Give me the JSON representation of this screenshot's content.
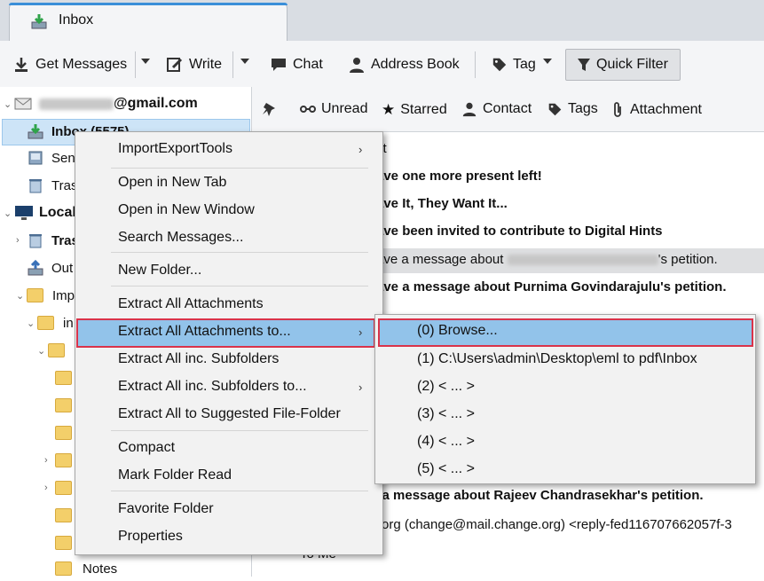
{
  "tab": {
    "title": "Inbox",
    "icon": "inbox-tray-icon"
  },
  "toolbar": {
    "get_messages": "Get Messages",
    "write": "Write",
    "chat": "Chat",
    "address_book": "Address Book",
    "tag": "Tag",
    "quick_filter": "Quick Filter"
  },
  "folders": {
    "account": "@gmail.com",
    "inbox": "Inbox (5575)",
    "sent": "Sen",
    "trash": "Tras",
    "local": "Local",
    "local_trash": "Tras",
    "outbox": "Out",
    "imp": "Imp",
    "in": "in",
    "sub": "I",
    "notes": "Notes"
  },
  "quickfilter": {
    "unread": "Unread",
    "starred": "Starred",
    "contact": "Contact",
    "tags": "Tags",
    "attachment": "Attachment"
  },
  "messages": [
    {
      "text": "ct",
      "bold": false
    },
    {
      "text": "ave one more present left!",
      "bold": true
    },
    {
      "text": "ave It, They Want It...",
      "bold": true
    },
    {
      "text": "ave been invited to contribute to Digital Hints",
      "bold": true
    },
    {
      "text": "ave a message about",
      "suffix": "'s petition.",
      "bold": false
    },
    {
      "text": "ave a message about Purnima Govindarajulu's petition.",
      "bold": true
    },
    {
      "text": "e a message about Rajeev Chandrasekhar's petition.",
      "bold": true
    },
    {
      "text": "org (change@mail.change.org) <reply-fed116707662057f-3",
      "bold": false
    },
    {
      "text": "To   Me",
      "bold": false
    }
  ],
  "context_menu": {
    "items": [
      {
        "label": "ImportExportTools",
        "submenu": true
      },
      {
        "label": "Open in New Tab"
      },
      {
        "label": "Open in New Window"
      },
      {
        "label": "Search Messages..."
      },
      {
        "label": "New Folder..."
      },
      {
        "label": "Extract All Attachments"
      },
      {
        "label": "Extract All Attachments to...",
        "submenu": true,
        "highlighted": true
      },
      {
        "label": "Extract All inc. Subfolders"
      },
      {
        "label": "Extract All inc. Subfolders to...",
        "submenu": true
      },
      {
        "label": "Extract All to Suggested File-Folder"
      },
      {
        "label": "Compact"
      },
      {
        "label": "Mark Folder Read"
      },
      {
        "label": "Favorite Folder"
      },
      {
        "label": "Properties"
      }
    ]
  },
  "submenu": {
    "items": [
      {
        "label": "(0) Browse...",
        "highlighted": true
      },
      {
        "label": "(1) C:\\Users\\admin\\Desktop\\eml to pdf\\Inbox"
      },
      {
        "label": "(2) < ... >"
      },
      {
        "label": "(3) < ... >"
      },
      {
        "label": "(4) < ... >"
      },
      {
        "label": "(5) < ... >"
      }
    ]
  },
  "colors": {
    "highlight": "#92c3ea",
    "outline": "#d9334a",
    "selection": "#cde4f7"
  }
}
